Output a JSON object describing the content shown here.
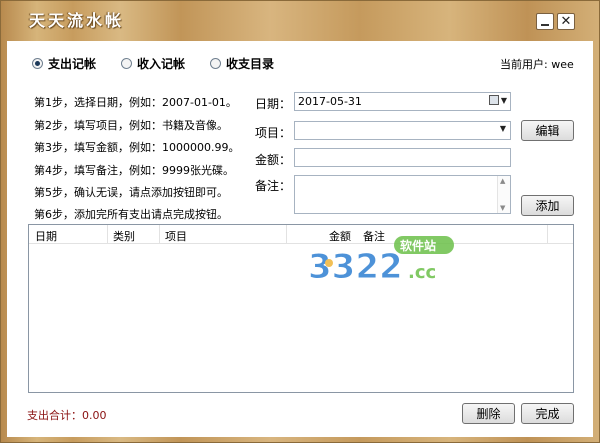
{
  "window": {
    "title": "天天流水帐",
    "minimize_icon": "minimize-icon",
    "close_icon": "close-icon",
    "close_glyph": "✕"
  },
  "modes": [
    {
      "label": "支出记帐",
      "checked": true
    },
    {
      "label": "收入记帐",
      "checked": false
    },
    {
      "label": "收支目录",
      "checked": false
    }
  ],
  "current_user": "当前用户: wee",
  "steps": [
    "第1步，选择日期，例如：2007-01-01。",
    "第2步，填写项目，例如：书籍及音像。",
    "第3步，填写金额，例如：1000000.99。",
    "第4步，填写备注，例如：9999张光碟。",
    "第5步，确认无误，请点添加按钮即可。",
    "第6步，添加完所有支出请点完成按钮。"
  ],
  "form": {
    "date_label": "日期：",
    "date_value": "2017-05-31",
    "item_label": "项目：",
    "item_value": "",
    "amount_label": "金额：",
    "amount_value": "",
    "note_label": "备注：",
    "note_value": ""
  },
  "buttons": {
    "edit": "编辑",
    "add": "添加",
    "delete": "删除",
    "done": "完成"
  },
  "table": {
    "columns": [
      "日期",
      "类别",
      "项目",
      "金额",
      "备注"
    ],
    "rows": []
  },
  "watermark": {
    "number": "3322",
    "suffix": ".cc",
    "badge": "软件站"
  },
  "total": "支出合计：0.00",
  "colors": {
    "title_text": "#ffffff",
    "total_text": "#8a1010",
    "watermark_blue": "#2f7fd2",
    "watermark_green": "#6cc04a",
    "watermark_yellow": "#f0b63a"
  }
}
